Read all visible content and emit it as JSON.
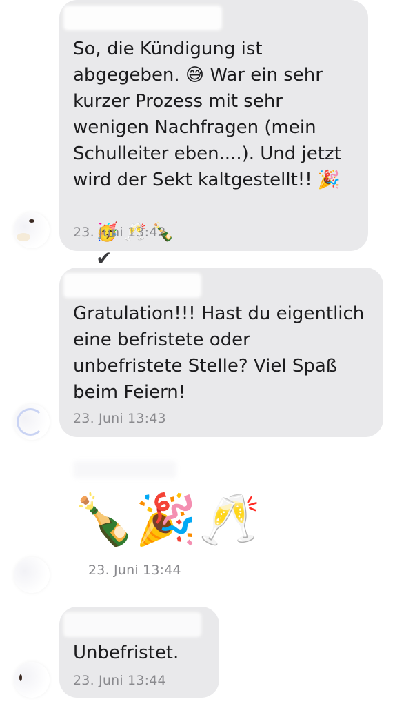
{
  "messages": [
    {
      "text": "So, die Kündigung ist\nabgegeben. 😅 War ein sehr\nkurzer Prozess mit sehr\nwenigen Nachfragen (mein\nSchulleiter eben....). Und jetzt\nwird der Sekt kaltgestellt!! 🎉",
      "emojis": "🥳 🥂 🍾",
      "check": "✔",
      "time": "23. Juni 13:42"
    },
    {
      "text": "Gratulation!!! Hast du eigentlich\neine befristete oder\nunbefristete Stelle? Viel Spaß\nbeim Feiern!",
      "time": "23. Juni 13:43"
    },
    {
      "emojis": [
        "🍾",
        "🎉",
        "🥂"
      ],
      "time": "23. Juni 13:44"
    },
    {
      "text": "Unbefristet.",
      "time": "23. Juni 13:44"
    }
  ]
}
